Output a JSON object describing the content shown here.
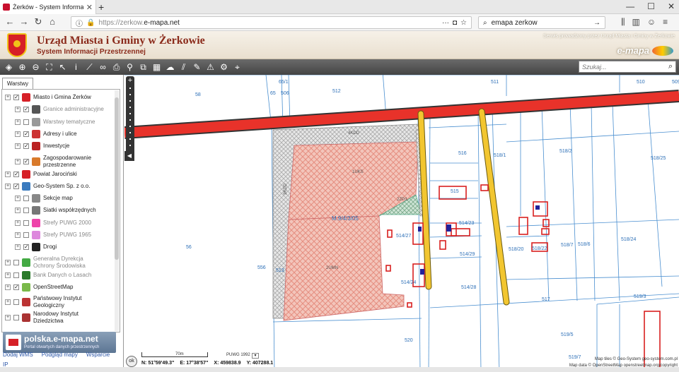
{
  "browser": {
    "tab_title": "Żerków - System Informacji P",
    "url_prefix": "https://zerkow.",
    "url_domain": "e-mapa.net",
    "search_value": "emapa zerkow"
  },
  "header": {
    "title": "Urząd Miasta i Gminy w Żerkowie",
    "subtitle": "System Informacji Przestrzennej",
    "service_note": "Serwis prowadzony przez Urząd Miasta i Gminy w Żerkowie",
    "brand": "e-mapa"
  },
  "toolbar": {
    "search_placeholder": "Szukaj..."
  },
  "panel": {
    "tab": "Warstwy",
    "layers": [
      {
        "label": "Miasto i Gmina Żerków",
        "indent": 0,
        "checked": true,
        "dim": false,
        "color": "#d62027"
      },
      {
        "label": "Granice administracyjne",
        "indent": 1,
        "checked": true,
        "dim": true,
        "color": "#555"
      },
      {
        "label": "Warstwy tematyczne",
        "indent": 1,
        "checked": false,
        "dim": true,
        "color": "#999"
      },
      {
        "label": "Adresy i ulice",
        "indent": 1,
        "checked": true,
        "dim": false,
        "color": "#c33"
      },
      {
        "label": "Inwestycje",
        "indent": 1,
        "checked": true,
        "dim": false,
        "color": "#b22"
      },
      {
        "label": "Zagospodarowanie przestrzenne",
        "indent": 1,
        "checked": true,
        "dim": false,
        "color": "#d97a2b"
      },
      {
        "label": "Powiat Jarociński",
        "indent": 0,
        "checked": true,
        "dim": false,
        "color": "#d62027"
      },
      {
        "label": "Geo-System Sp. z o.o.",
        "indent": 0,
        "checked": true,
        "dim": false,
        "color": "#3a7bbf"
      },
      {
        "label": "Sekcje map",
        "indent": 1,
        "checked": false,
        "dim": false,
        "color": "#888"
      },
      {
        "label": "Siatki współrzędnych",
        "indent": 1,
        "checked": false,
        "dim": false,
        "color": "#777"
      },
      {
        "label": "Strefy PUWG 2000",
        "indent": 1,
        "checked": false,
        "dim": true,
        "color": "#e4a"
      },
      {
        "label": "Strefy PUWG 1965",
        "indent": 1,
        "checked": false,
        "dim": true,
        "color": "#d8d"
      },
      {
        "label": "Drogi",
        "indent": 1,
        "checked": true,
        "dim": false,
        "color": "#222"
      },
      {
        "label": "Generalna Dyrekcja Ochrony Środowiska",
        "indent": 0,
        "checked": false,
        "dim": true,
        "color": "#4a4"
      },
      {
        "label": "Bank Danych o Lasach",
        "indent": 0,
        "checked": false,
        "dim": true,
        "color": "#2a7a2a"
      },
      {
        "label": "OpenStreetMap",
        "indent": 0,
        "checked": true,
        "dim": false,
        "color": "#7ab94a"
      },
      {
        "label": "Państwowy Instytut Geologiczny",
        "indent": 0,
        "checked": false,
        "dim": false,
        "color": "#b33"
      },
      {
        "label": "Narodowy Instytut Dziedzictwa",
        "indent": 0,
        "checked": false,
        "dim": false,
        "color": "#a33"
      }
    ],
    "promo_title": "polska.e-mapa.net",
    "promo_subtitle": "Portal otwartych danych przestrzennych",
    "links": [
      "Dodaj WMS",
      "Podgląd mapy",
      "Wsparcie"
    ],
    "extra": "IP"
  },
  "map": {
    "parcel_labels": [
      {
        "t": "58"
      },
      {
        "t": "65/1"
      },
      {
        "t": "65"
      },
      {
        "t": "506"
      },
      {
        "t": "512"
      },
      {
        "t": "511"
      },
      {
        "t": "510"
      },
      {
        "t": "509"
      },
      {
        "t": "516"
      },
      {
        "t": "518/1"
      },
      {
        "t": "518/2"
      },
      {
        "t": "518/25"
      },
      {
        "t": "515"
      },
      {
        "t": "514/23"
      },
      {
        "t": "514/27"
      },
      {
        "t": "514/29"
      },
      {
        "t": "514/28"
      },
      {
        "t": "514/24"
      },
      {
        "t": "518/20"
      },
      {
        "t": "518/22"
      },
      {
        "t": "518/7"
      },
      {
        "t": "518/6"
      },
      {
        "t": "518/24"
      },
      {
        "t": "56"
      },
      {
        "t": "556"
      },
      {
        "t": "513"
      },
      {
        "t": "517"
      },
      {
        "t": "519/5"
      },
      {
        "t": "519/7"
      },
      {
        "t": "519/3"
      },
      {
        "t": "520"
      }
    ],
    "zone_labels": [
      "4KDD",
      "1UKS",
      "3KDD",
      "2ZP/L",
      "2UMN"
    ],
    "center_label": "M.9/4/3/05",
    "scale_text": "70m",
    "crs": "PUWG 1992",
    "ok_label": "ok",
    "coord_n": "N: 51°59'49.3\"",
    "coord_e": "E: 17°38'57\"",
    "coord_x": "X: 459838.9",
    "coord_y": "Y: 407288.1",
    "attribution_1": "Map tiles © Geo-System geo-system.com.pl",
    "attribution_2": "Map data © OpenStreetMap openstreetmap.org/copyright"
  }
}
